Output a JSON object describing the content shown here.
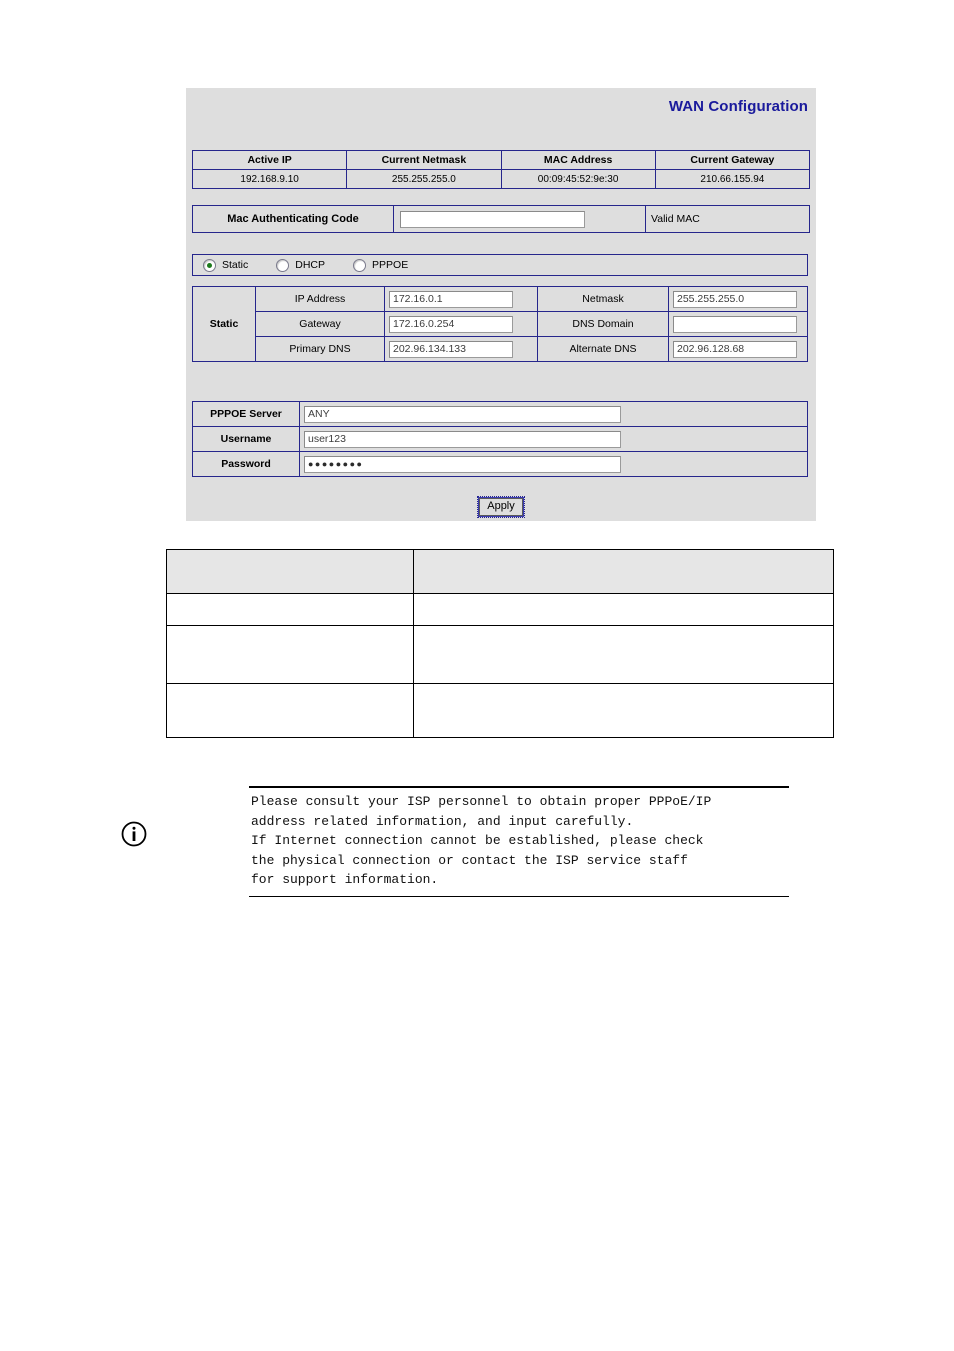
{
  "panel": {
    "title": "WAN Configuration",
    "status_table": {
      "headers": [
        "Active IP",
        "Current Netmask",
        "MAC Address",
        "Current Gateway"
      ],
      "values": [
        "192.168.9.10",
        "255.255.255.0",
        "00:09:45:52:9e:30",
        "210.66.155.94"
      ]
    },
    "mac_auth": {
      "label": "Mac Authenticating Code",
      "value": "",
      "placeholder": "",
      "valid_label": "Valid MAC"
    },
    "mode": {
      "options": [
        {
          "label": "Static",
          "selected": true
        },
        {
          "label": "DHCP",
          "selected": false
        },
        {
          "label": "PPPOE",
          "selected": false
        }
      ]
    },
    "static": {
      "section_label": "Static",
      "fields": [
        {
          "label": "IP Address",
          "value": "172.16.0.1",
          "label2": "Netmask",
          "value2": "255.255.255.0"
        },
        {
          "label": "Gateway",
          "value": "172.16.0.254",
          "label2": "DNS Domain",
          "value2": ""
        },
        {
          "label": "Primary DNS",
          "value": "202.96.134.133",
          "label2": "Alternate DNS",
          "value2": "202.96.128.68"
        }
      ]
    },
    "pppoe": {
      "fields": [
        {
          "label": "PPPOE Server",
          "value": "ANY"
        },
        {
          "label": "Username",
          "value": "user123"
        },
        {
          "label": "Password",
          "value": "●●●●●●●●"
        }
      ]
    },
    "apply_label": "Apply",
    "colors": {
      "panel_background": "#dedede",
      "title": "#1a1a9c",
      "table_border": "#26268c",
      "radio_selected": "#1d7a1d"
    }
  },
  "description_table": {
    "header": [
      "",
      ""
    ],
    "rows": [
      [
        "",
        ""
      ],
      [
        "",
        ""
      ],
      [
        "",
        ""
      ]
    ]
  },
  "note": {
    "icon": "info-icon",
    "text": "Please consult your ISP personnel to obtain proper PPPoE/IP\naddress related information, and input carefully.\nIf Internet connection cannot be established, please check\nthe physical connection or contact the ISP service staff\nfor support information."
  }
}
